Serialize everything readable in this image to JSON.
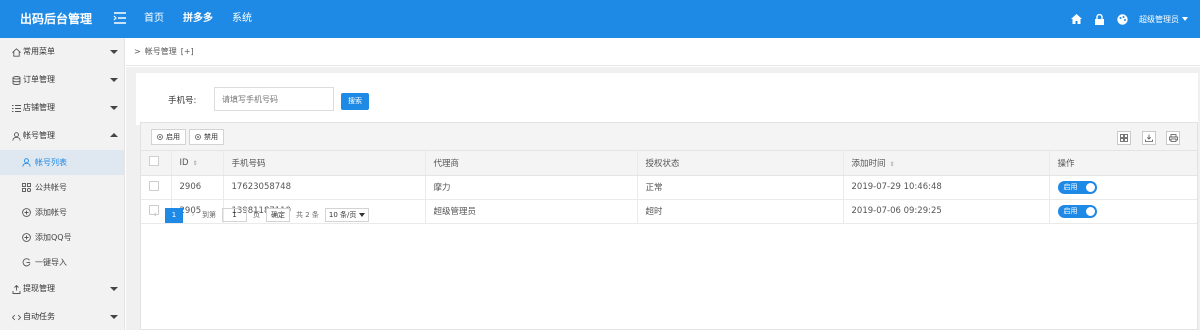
{
  "app": {
    "title": "出码后台管理"
  },
  "topnav": {
    "items": [
      "首页",
      "拼多多",
      "系统"
    ],
    "user": "超级管理员"
  },
  "sidebar": {
    "groups": [
      {
        "label": "常用菜单"
      },
      {
        "label": "订单管理"
      },
      {
        "label": "店铺管理"
      },
      {
        "label": "帐号管理"
      }
    ],
    "sub": [
      {
        "label": "帐号列表"
      },
      {
        "label": "公共帐号"
      },
      {
        "label": "添加帐号"
      },
      {
        "label": "添加QQ号"
      },
      {
        "label": "一键导入"
      }
    ],
    "more": [
      {
        "label": "提现管理"
      },
      {
        "label": "自动任务"
      }
    ]
  },
  "breadcrumb": {
    "sep": ">",
    "page": "帐号管理",
    "plus": "[+]"
  },
  "search": {
    "label": "手机号:",
    "placeholder": "请填写手机号码",
    "button": "搜索"
  },
  "toolbar": {
    "enable": "启用",
    "disable": "禁用"
  },
  "table": {
    "columns": [
      "ID",
      "手机号码",
      "代理商",
      "授权状态",
      "添加时间",
      "操作"
    ],
    "rows": [
      {
        "id": "2906",
        "phone": "17623058748",
        "agent": "摩力",
        "status": "正常",
        "time": "2019-07-29 10:46:48",
        "action": "启用"
      },
      {
        "id": "2905",
        "phone": "13981187119",
        "agent": "超级管理员",
        "status": "超时",
        "time": "2019-07-06 09:29:25",
        "action": "启用"
      }
    ]
  },
  "pager": {
    "current": "1",
    "goto": "到第",
    "page_value": "1",
    "page_unit": "页",
    "confirm": "确定",
    "total": "共 2 条",
    "size": "10 条/页"
  },
  "colors": {
    "primary": "#1e8ae6",
    "ok": "#2e9e2e",
    "bad": "#d9534f"
  }
}
